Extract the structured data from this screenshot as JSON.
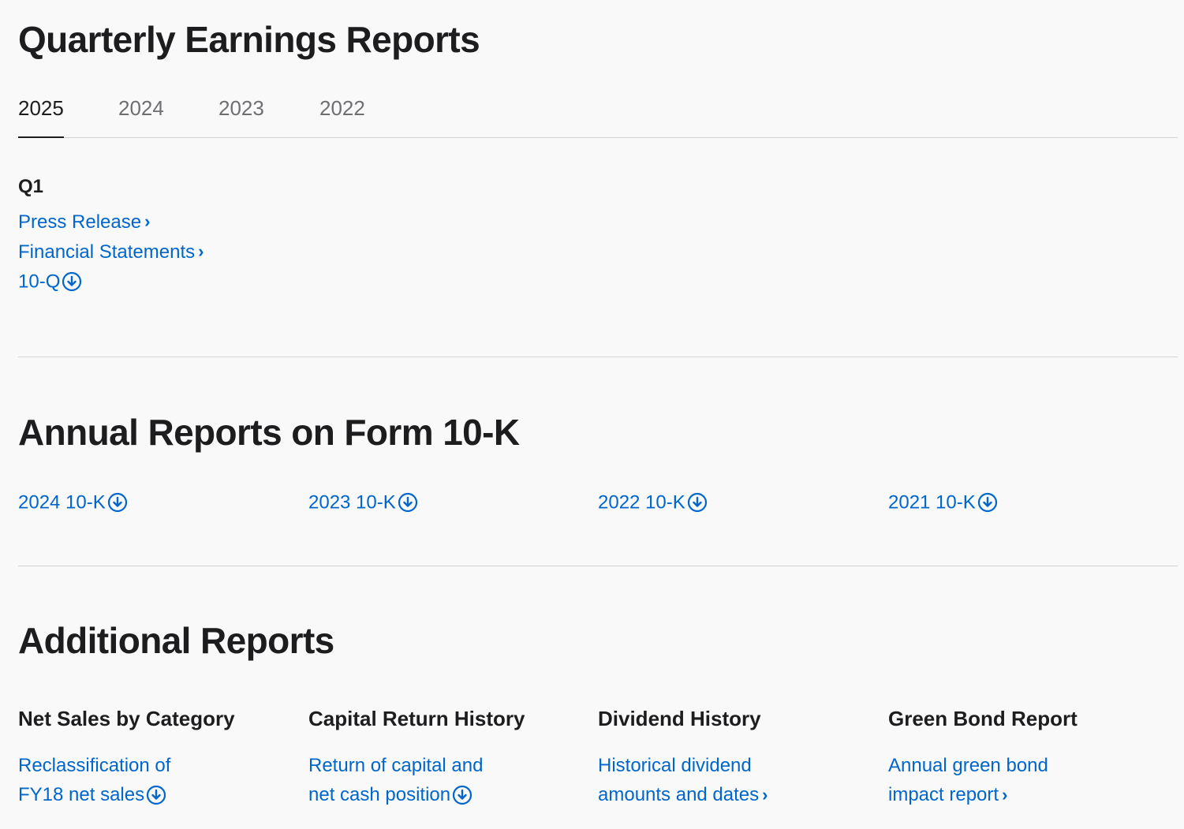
{
  "quarterly": {
    "title": "Quarterly Earnings Reports",
    "tabs": [
      "2025",
      "2024",
      "2023",
      "2022"
    ],
    "active_tab": "2025",
    "quarter": {
      "heading": "Q1",
      "links": {
        "press_release": "Press Release",
        "financial_statements": "Financial Statements",
        "ten_q": "10-Q"
      }
    }
  },
  "annual": {
    "title": "Annual Reports on Form 10-K",
    "reports": [
      "2024 10-K",
      "2023 10-K",
      "2022 10-K",
      "2021 10-K"
    ]
  },
  "additional": {
    "title": "Additional Reports",
    "columns": [
      {
        "heading": "Net Sales by Category",
        "link_line1": "Reclassification of",
        "link_line2": "FY18 net sales",
        "icon": "download-icon"
      },
      {
        "heading": "Capital Return History",
        "link_line1": "Return of capital and",
        "link_line2": "net cash position",
        "icon": "download-icon"
      },
      {
        "heading": "Dividend History",
        "link_line1": "Historical dividend",
        "link_line2": "amounts and dates",
        "icon": "chevron-right-icon"
      },
      {
        "heading": "Green Bond Report",
        "link_line1": "Annual green bond",
        "link_line2": "impact report",
        "icon": "chevron-right-icon"
      }
    ]
  },
  "colors": {
    "link": "#0066cc",
    "text": "#1d1d1f",
    "muted": "#6e6e73",
    "divider": "#d2d2d7",
    "background": "#f9f9f9"
  }
}
